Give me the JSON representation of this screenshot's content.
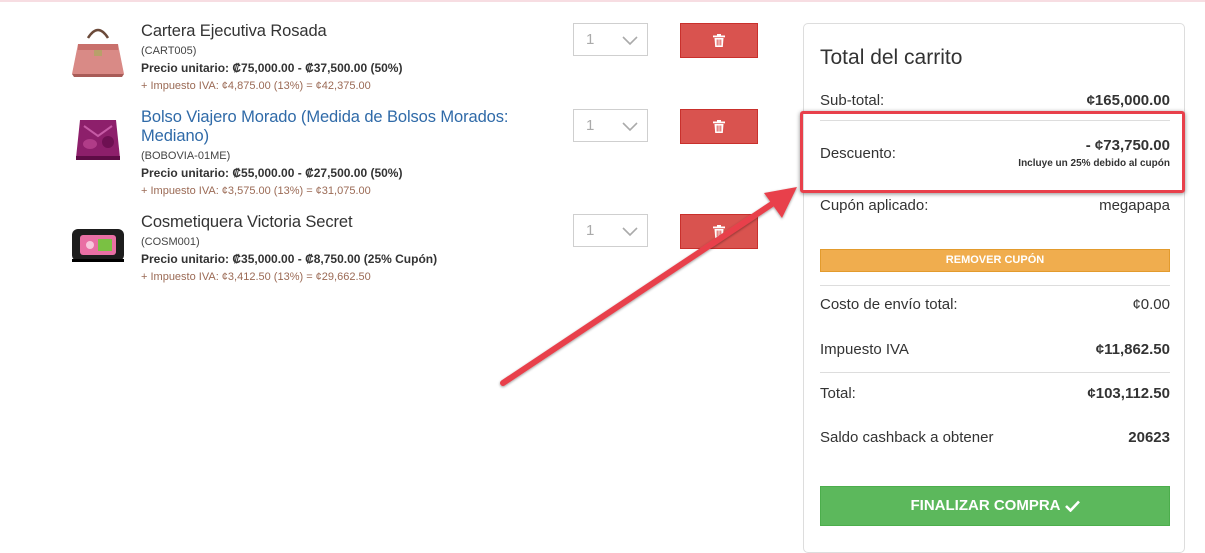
{
  "cart": {
    "items": [
      {
        "name": "Cartera Ejecutiva Rosada",
        "sku": "(CART005)",
        "price": "Precio unitario: ₡75,000.00 - ₡37,500.00 (50%)",
        "tax": "+ Impuesto IVA: ¢4,875.00 (13%) = ¢42,375.00",
        "qty": "1",
        "product_icon": "pink-handbag-photo"
      },
      {
        "name": "Bolso Viajero Morado (Medida de Bolsos Morados: Mediano)",
        "sku": "(BOBOVIA-01ME)",
        "price": "Precio unitario: ₡55,000.00 - ₡27,500.00 (50%)",
        "tax": "+ Impuesto IVA: ¢3,575.00 (13%) = ¢31,075.00",
        "qty": "1",
        "product_icon": "purple-bag-photo"
      },
      {
        "name": "Cosmetiquera Victoria Secret",
        "sku": "(COSM001)",
        "price": "Precio unitario: ₡35,000.00 - ₡8,750.00 (25% Cupón)",
        "tax": "+ Impuesto IVA: ¢3,412.50 (13%) = ¢29,662.50",
        "qty": "1",
        "product_icon": "cosmetic-bag-photo"
      }
    ],
    "delete_icon": "trash-icon"
  },
  "summary": {
    "title": "Total del carrito",
    "subtotal_label": "Sub-total:",
    "subtotal_value": "¢165,000.00",
    "discount_label": "Descuento:",
    "discount_value": "- ¢73,750.00",
    "discount_note": "Incluye un 25% debido al cupón",
    "coupon_label": "Cupón aplicado:",
    "coupon_value": "megapapa",
    "remove_coupon": "REMOVER CUPÓN",
    "shipping_label": "Costo de envío total:",
    "shipping_value": "¢0.00",
    "tax_label": "Impuesto IVA",
    "tax_value": "¢11,862.50",
    "total_label": "Total:",
    "total_value": "¢103,112.50",
    "cashback_label": "Saldo cashback a obtener",
    "cashback_value": "20623",
    "finish_button": "FINALIZAR COMPRA"
  },
  "colors": {
    "danger": "#d9534f",
    "warning": "#f0ad4e",
    "success": "#5cb85c",
    "link": "#2f6aa8",
    "annotation": "#e8404b"
  }
}
